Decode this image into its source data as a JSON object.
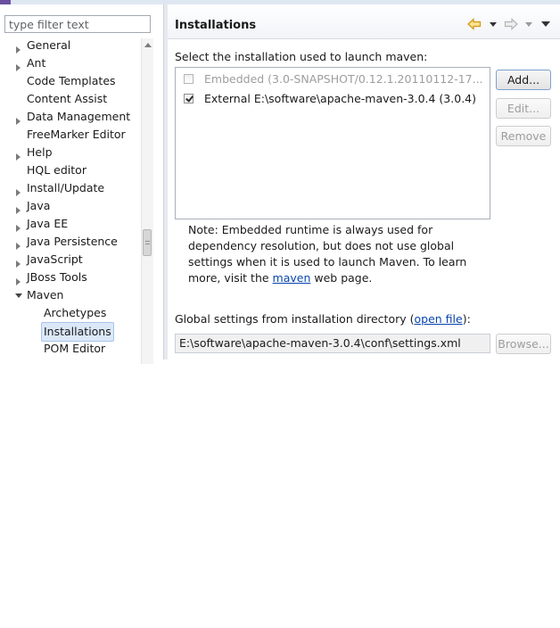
{
  "filter": {
    "placeholder": "type filter text"
  },
  "tree": {
    "items": [
      {
        "label": "General",
        "arrow": "right",
        "level": 0
      },
      {
        "label": "Ant",
        "arrow": "right",
        "level": 0
      },
      {
        "label": "Code Templates",
        "arrow": "none",
        "level": 0
      },
      {
        "label": "Content Assist",
        "arrow": "none",
        "level": 0
      },
      {
        "label": "Data Management",
        "arrow": "right",
        "level": 0
      },
      {
        "label": "FreeMarker Editor",
        "arrow": "none",
        "level": 0
      },
      {
        "label": "Help",
        "arrow": "right",
        "level": 0
      },
      {
        "label": "HQL editor",
        "arrow": "none",
        "level": 0
      },
      {
        "label": "Install/Update",
        "arrow": "right",
        "level": 0
      },
      {
        "label": "Java",
        "arrow": "right",
        "level": 0
      },
      {
        "label": "Java EE",
        "arrow": "right",
        "level": 0
      },
      {
        "label": "Java Persistence",
        "arrow": "right",
        "level": 0
      },
      {
        "label": "JavaScript",
        "arrow": "right",
        "level": 0
      },
      {
        "label": "JBoss Tools",
        "arrow": "right",
        "level": 0
      },
      {
        "label": "Maven",
        "arrow": "down",
        "level": 0
      },
      {
        "label": "Archetypes",
        "arrow": "none",
        "level": 1
      },
      {
        "label": "Installations",
        "arrow": "none",
        "level": 1,
        "selected": true
      },
      {
        "label": "POM Editor",
        "arrow": "none",
        "level": 1
      }
    ]
  },
  "header": {
    "title": "Installations"
  },
  "instruction": "Select the installation used to launch maven:",
  "installations": [
    {
      "label": "Embedded (3.0-SNAPSHOT/0.12.1.20110112-17...",
      "checked": false,
      "disabled": true
    },
    {
      "label": "External E:\\software\\apache-maven-3.0.4 (3.0.4)",
      "checked": true,
      "disabled": false
    }
  ],
  "buttons": {
    "add": "Add...",
    "edit": "Edit...",
    "remove": "Remove",
    "browse": "Browse..."
  },
  "note": {
    "text_before": "Note: Embedded runtime is always used for dependency resolution, but does not use global settings when it is used to launch Maven. To learn more, visit the ",
    "link": "maven",
    "text_after": " web page."
  },
  "global_settings": {
    "label_before": "Global settings from installation directory (",
    "link": "open file",
    "label_after": "):",
    "value": "E:\\software\\apache-maven-3.0.4\\conf\\settings.xml"
  },
  "colors": {
    "selection": "#dbe8f8",
    "link": "#0645ad",
    "back_arrow": "#e8a317"
  }
}
